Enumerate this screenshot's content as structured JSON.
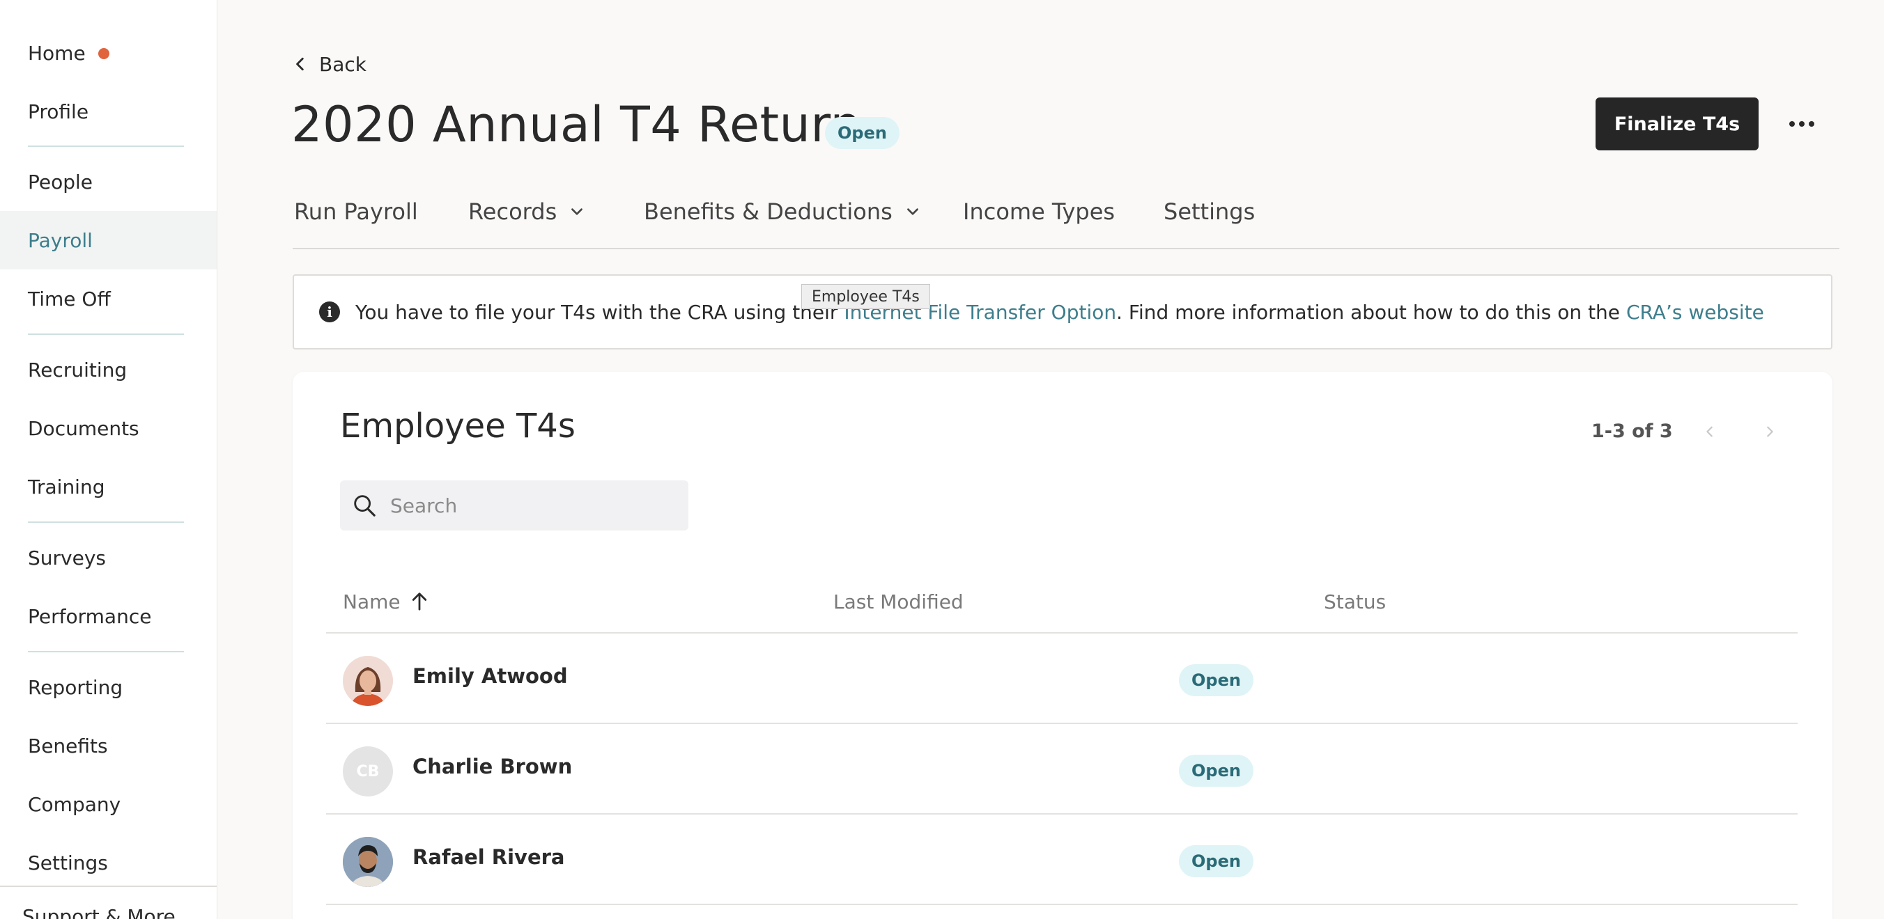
{
  "sidebar": {
    "items": [
      {
        "label": "Home"
      },
      {
        "label": "Profile"
      },
      {
        "label": "People"
      },
      {
        "label": "Payroll"
      },
      {
        "label": "Time Off"
      },
      {
        "label": "Recruiting"
      },
      {
        "label": "Documents"
      },
      {
        "label": "Training"
      },
      {
        "label": "Surveys"
      },
      {
        "label": "Performance"
      },
      {
        "label": "Reporting"
      },
      {
        "label": "Benefits"
      },
      {
        "label": "Company"
      },
      {
        "label": "Settings"
      }
    ],
    "active": "Payroll",
    "cutoff_label": "Support & More"
  },
  "header": {
    "back_label": "Back",
    "title": "2020 Annual T4 Return",
    "status_badge": "Open",
    "finalize_label": "Finalize T4s"
  },
  "tabs": [
    {
      "label": "Run Payroll"
    },
    {
      "label": "Records"
    },
    {
      "label": "Benefits & Deductions"
    },
    {
      "label": "Income Types"
    },
    {
      "label": "Settings"
    }
  ],
  "banner": {
    "text_before": "You have to file your T4s with the CRA using their ",
    "link1": "Internet File Transfer Option",
    "text_middle": ". Find more information about how to do this on the ",
    "link2": "CRA’s website"
  },
  "tooltip": "Employee T4s",
  "table_card": {
    "title": "Employee T4s",
    "pagination": "1-3 of 3",
    "search_placeholder": "Search",
    "columns": {
      "name": "Name",
      "last_modified": "Last Modified",
      "status": "Status"
    },
    "rows": [
      {
        "name": "Emily Atwood",
        "last_modified": "",
        "status": "Open",
        "avatar": "photo-woman"
      },
      {
        "name": "Charlie Brown",
        "last_modified": "",
        "status": "Open",
        "avatar": "CB"
      },
      {
        "name": "Rafael Rivera",
        "last_modified": "",
        "status": "Open",
        "avatar": "photo-man"
      }
    ]
  },
  "colors": {
    "accent_teal": "#3e7e8c",
    "notification_dot": "#e0643c",
    "badge_bg": "#dff4f6",
    "primary_button": "#262626"
  },
  "icons": {
    "back": "chevron-left-icon",
    "more": "ellipsis-icon",
    "dropdown": "chevron-down-icon",
    "info": "info-icon",
    "search": "search-icon",
    "sort": "arrow-up-icon",
    "prev_page": "chevron-left-icon",
    "next_page": "chevron-right-icon"
  }
}
